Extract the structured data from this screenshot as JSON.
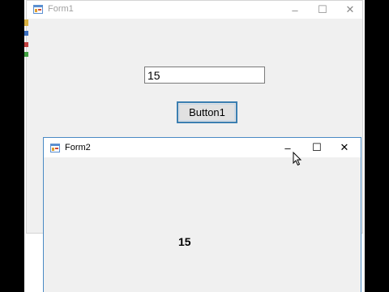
{
  "form1": {
    "title": "Form1",
    "textbox_value": "15",
    "button_label": "Button1",
    "controls": {
      "minimize": "–",
      "maximize": "☐",
      "close": "✕"
    }
  },
  "form2": {
    "title": "Form2",
    "label_text": "15",
    "controls": {
      "minimize": "–",
      "maximize": "☐",
      "close": "✕"
    }
  },
  "colors": {
    "form_bg": "#f0f0f0",
    "active_border": "#4a8ac4",
    "button_border": "#3c7fb1"
  }
}
